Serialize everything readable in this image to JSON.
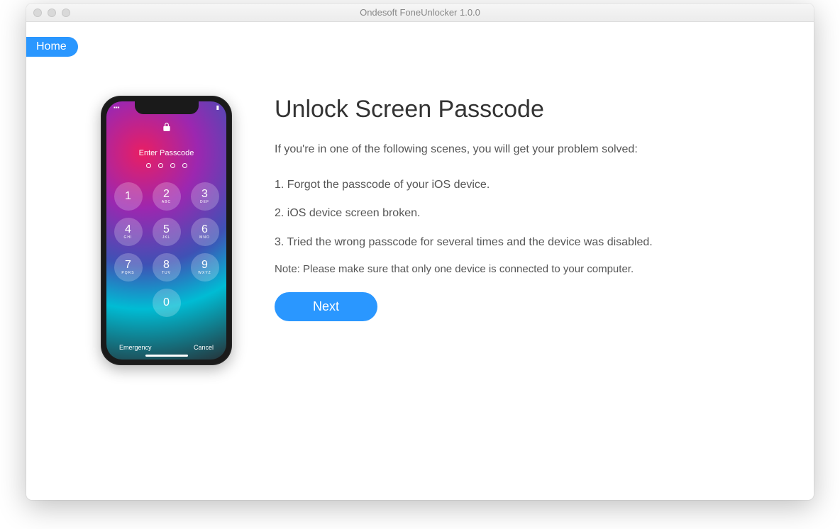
{
  "window": {
    "title": "Ondesoft FoneUnlocker 1.0.0"
  },
  "nav": {
    "home_label": "Home"
  },
  "phone": {
    "enter_passcode": "Enter Passcode",
    "emergency": "Emergency",
    "cancel": "Cancel",
    "keys": {
      "k1": "1",
      "k2": "2",
      "k2l": "ABC",
      "k3": "3",
      "k3l": "DEF",
      "k4": "4",
      "k4l": "GHI",
      "k5": "5",
      "k5l": "JKL",
      "k6": "6",
      "k6l": "MNO",
      "k7": "7",
      "k7l": "PQRS",
      "k8": "8",
      "k8l": "TUV",
      "k9": "9",
      "k9l": "WXYZ",
      "k0": "0"
    }
  },
  "main": {
    "title": "Unlock Screen Passcode",
    "intro": "If you're in one of the following scenes, you will get your problem solved:",
    "scene1": "1. Forgot the passcode of your iOS device.",
    "scene2": "2. iOS device screen broken.",
    "scene3": "3. Tried the wrong passcode for several times and the device was disabled.",
    "note": "Note: Please make sure that only one device is connected to your computer.",
    "next_label": "Next"
  }
}
